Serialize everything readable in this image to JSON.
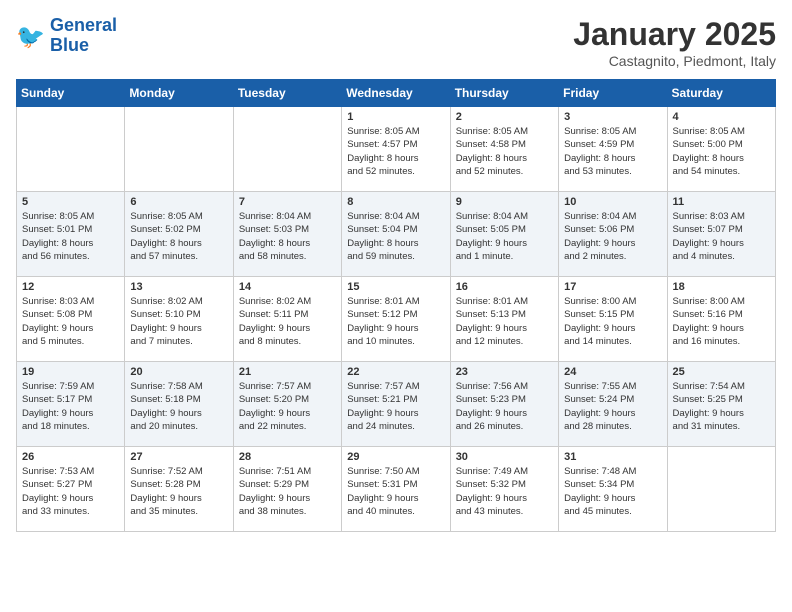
{
  "header": {
    "logo_line1": "General",
    "logo_line2": "Blue",
    "month_title": "January 2025",
    "location": "Castagnito, Piedmont, Italy"
  },
  "days_of_week": [
    "Sunday",
    "Monday",
    "Tuesday",
    "Wednesday",
    "Thursday",
    "Friday",
    "Saturday"
  ],
  "weeks": [
    [
      {
        "day": "",
        "info": ""
      },
      {
        "day": "",
        "info": ""
      },
      {
        "day": "",
        "info": ""
      },
      {
        "day": "1",
        "info": "Sunrise: 8:05 AM\nSunset: 4:57 PM\nDaylight: 8 hours\nand 52 minutes."
      },
      {
        "day": "2",
        "info": "Sunrise: 8:05 AM\nSunset: 4:58 PM\nDaylight: 8 hours\nand 52 minutes."
      },
      {
        "day": "3",
        "info": "Sunrise: 8:05 AM\nSunset: 4:59 PM\nDaylight: 8 hours\nand 53 minutes."
      },
      {
        "day": "4",
        "info": "Sunrise: 8:05 AM\nSunset: 5:00 PM\nDaylight: 8 hours\nand 54 minutes."
      }
    ],
    [
      {
        "day": "5",
        "info": "Sunrise: 8:05 AM\nSunset: 5:01 PM\nDaylight: 8 hours\nand 56 minutes."
      },
      {
        "day": "6",
        "info": "Sunrise: 8:05 AM\nSunset: 5:02 PM\nDaylight: 8 hours\nand 57 minutes."
      },
      {
        "day": "7",
        "info": "Sunrise: 8:04 AM\nSunset: 5:03 PM\nDaylight: 8 hours\nand 58 minutes."
      },
      {
        "day": "8",
        "info": "Sunrise: 8:04 AM\nSunset: 5:04 PM\nDaylight: 8 hours\nand 59 minutes."
      },
      {
        "day": "9",
        "info": "Sunrise: 8:04 AM\nSunset: 5:05 PM\nDaylight: 9 hours\nand 1 minute."
      },
      {
        "day": "10",
        "info": "Sunrise: 8:04 AM\nSunset: 5:06 PM\nDaylight: 9 hours\nand 2 minutes."
      },
      {
        "day": "11",
        "info": "Sunrise: 8:03 AM\nSunset: 5:07 PM\nDaylight: 9 hours\nand 4 minutes."
      }
    ],
    [
      {
        "day": "12",
        "info": "Sunrise: 8:03 AM\nSunset: 5:08 PM\nDaylight: 9 hours\nand 5 minutes."
      },
      {
        "day": "13",
        "info": "Sunrise: 8:02 AM\nSunset: 5:10 PM\nDaylight: 9 hours\nand 7 minutes."
      },
      {
        "day": "14",
        "info": "Sunrise: 8:02 AM\nSunset: 5:11 PM\nDaylight: 9 hours\nand 8 minutes."
      },
      {
        "day": "15",
        "info": "Sunrise: 8:01 AM\nSunset: 5:12 PM\nDaylight: 9 hours\nand 10 minutes."
      },
      {
        "day": "16",
        "info": "Sunrise: 8:01 AM\nSunset: 5:13 PM\nDaylight: 9 hours\nand 12 minutes."
      },
      {
        "day": "17",
        "info": "Sunrise: 8:00 AM\nSunset: 5:15 PM\nDaylight: 9 hours\nand 14 minutes."
      },
      {
        "day": "18",
        "info": "Sunrise: 8:00 AM\nSunset: 5:16 PM\nDaylight: 9 hours\nand 16 minutes."
      }
    ],
    [
      {
        "day": "19",
        "info": "Sunrise: 7:59 AM\nSunset: 5:17 PM\nDaylight: 9 hours\nand 18 minutes."
      },
      {
        "day": "20",
        "info": "Sunrise: 7:58 AM\nSunset: 5:18 PM\nDaylight: 9 hours\nand 20 minutes."
      },
      {
        "day": "21",
        "info": "Sunrise: 7:57 AM\nSunset: 5:20 PM\nDaylight: 9 hours\nand 22 minutes."
      },
      {
        "day": "22",
        "info": "Sunrise: 7:57 AM\nSunset: 5:21 PM\nDaylight: 9 hours\nand 24 minutes."
      },
      {
        "day": "23",
        "info": "Sunrise: 7:56 AM\nSunset: 5:23 PM\nDaylight: 9 hours\nand 26 minutes."
      },
      {
        "day": "24",
        "info": "Sunrise: 7:55 AM\nSunset: 5:24 PM\nDaylight: 9 hours\nand 28 minutes."
      },
      {
        "day": "25",
        "info": "Sunrise: 7:54 AM\nSunset: 5:25 PM\nDaylight: 9 hours\nand 31 minutes."
      }
    ],
    [
      {
        "day": "26",
        "info": "Sunrise: 7:53 AM\nSunset: 5:27 PM\nDaylight: 9 hours\nand 33 minutes."
      },
      {
        "day": "27",
        "info": "Sunrise: 7:52 AM\nSunset: 5:28 PM\nDaylight: 9 hours\nand 35 minutes."
      },
      {
        "day": "28",
        "info": "Sunrise: 7:51 AM\nSunset: 5:29 PM\nDaylight: 9 hours\nand 38 minutes."
      },
      {
        "day": "29",
        "info": "Sunrise: 7:50 AM\nSunset: 5:31 PM\nDaylight: 9 hours\nand 40 minutes."
      },
      {
        "day": "30",
        "info": "Sunrise: 7:49 AM\nSunset: 5:32 PM\nDaylight: 9 hours\nand 43 minutes."
      },
      {
        "day": "31",
        "info": "Sunrise: 7:48 AM\nSunset: 5:34 PM\nDaylight: 9 hours\nand 45 minutes."
      },
      {
        "day": "",
        "info": ""
      }
    ]
  ]
}
